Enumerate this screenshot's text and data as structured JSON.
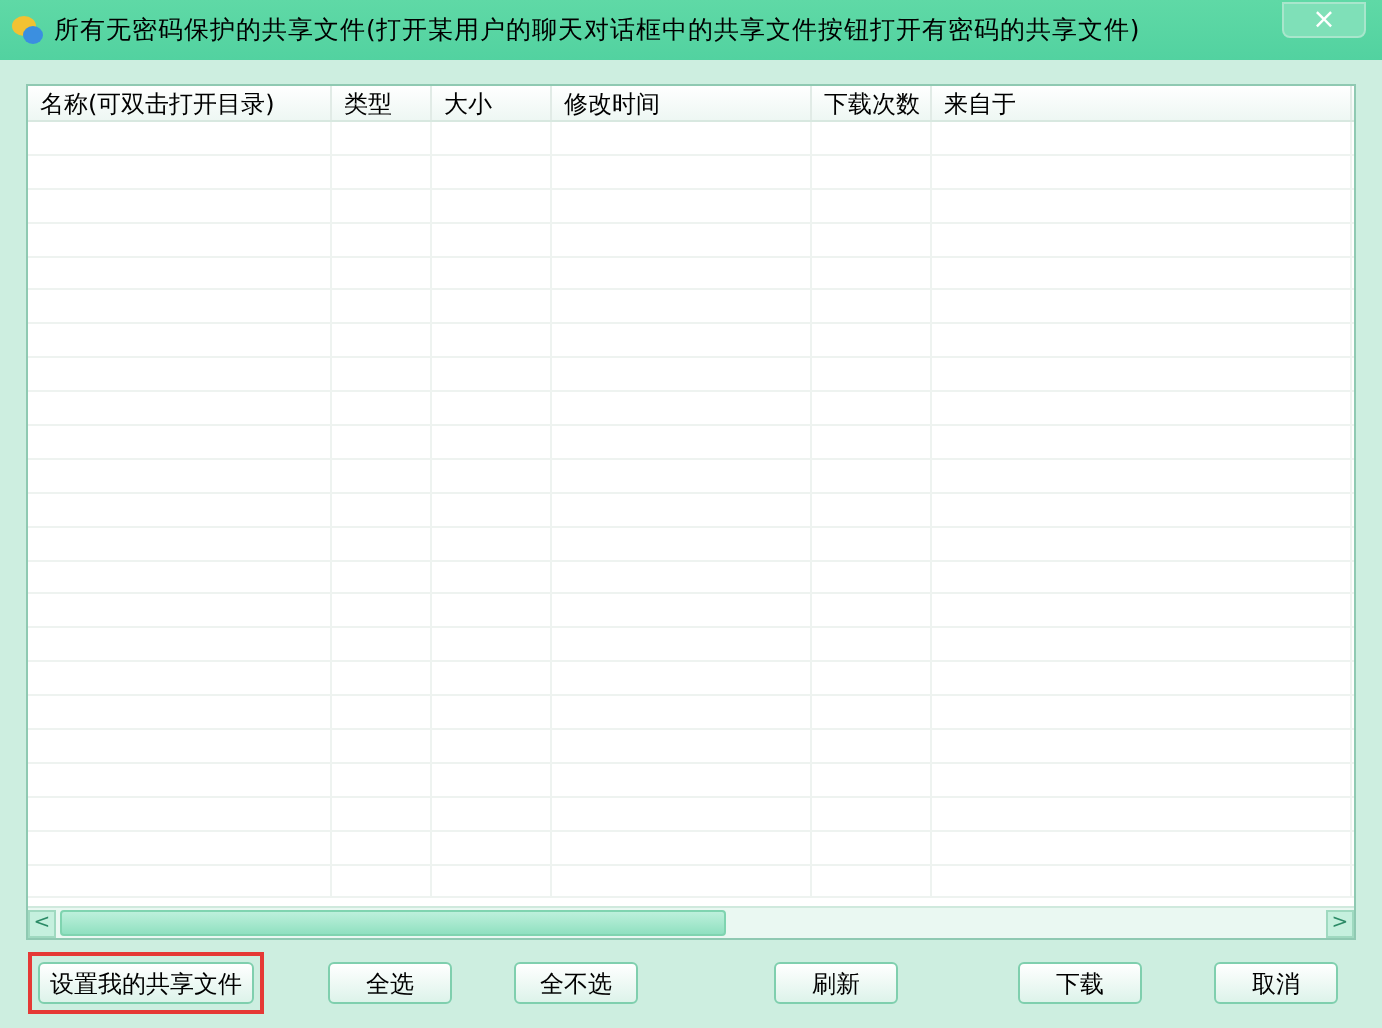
{
  "window": {
    "title": "所有无密码保护的共享文件(打开某用户的聊天对话框中的共享文件按钮打开有密码的共享文件)",
    "close": "×"
  },
  "table": {
    "columns": [
      "名称(可双击打开目录)",
      "类型",
      "大小",
      "修改时间",
      "下载次数",
      "来自于"
    ],
    "scrollbar": {
      "left": "<",
      "right": ">"
    }
  },
  "buttons": [
    {
      "label": "设置我的共享文件",
      "highlighted": true
    },
    {
      "label": "全选",
      "highlighted": false
    },
    {
      "label": "全不选",
      "highlighted": false
    },
    {
      "label": "刷新",
      "highlighted": false
    },
    {
      "label": "下载",
      "highlighted": false
    },
    {
      "label": "取消",
      "highlighted": false
    }
  ]
}
